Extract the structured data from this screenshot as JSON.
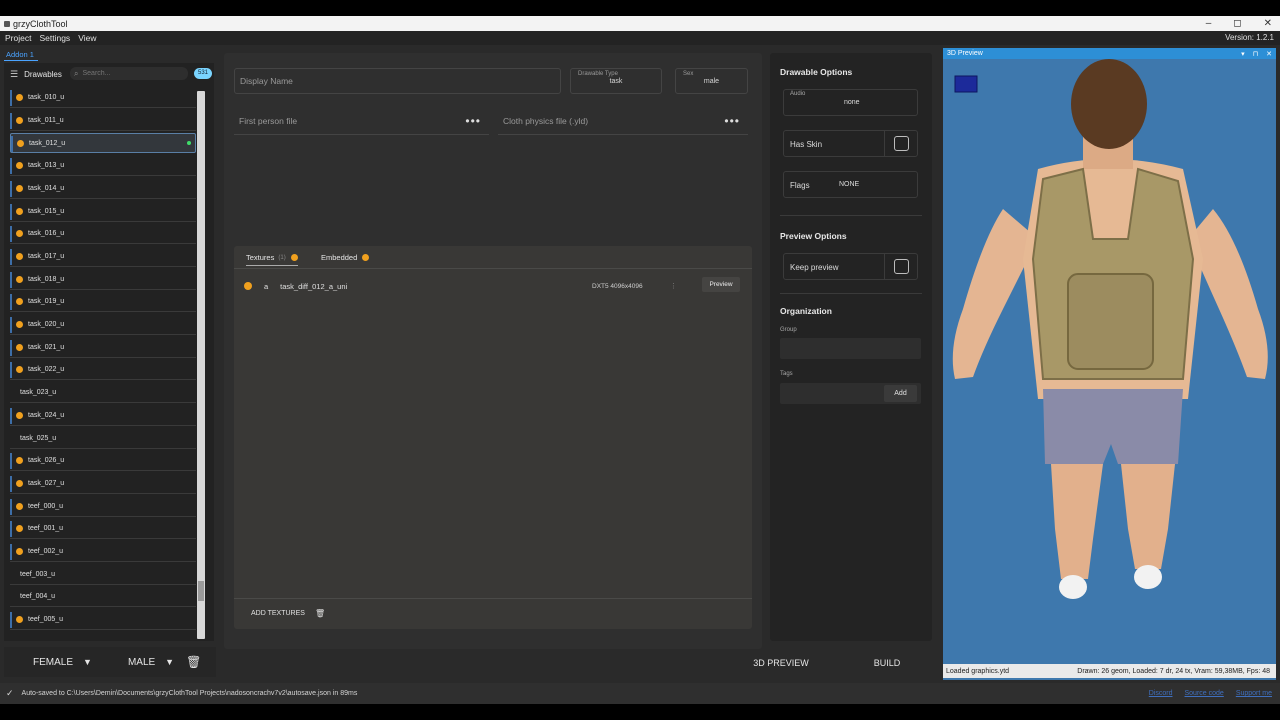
{
  "window": {
    "title": "grzyClothTool",
    "minimize": "–",
    "maximize": "◻",
    "close": "✕"
  },
  "menu": {
    "items": [
      "Project",
      "Settings",
      "View"
    ],
    "version": "Version: 1.2.1"
  },
  "sidebar": {
    "addon_tab": "Addon 1",
    "title": "Drawables",
    "search_placeholder": "Search...",
    "count": "531",
    "items": [
      {
        "label": "task_010_u",
        "warn": true
      },
      {
        "label": "task_011_u",
        "warn": true
      },
      {
        "label": "task_012_u",
        "warn": true,
        "selected": true
      },
      {
        "label": "task_013_u",
        "warn": true
      },
      {
        "label": "task_014_u",
        "warn": true
      },
      {
        "label": "task_015_u",
        "warn": true
      },
      {
        "label": "task_016_u",
        "warn": true
      },
      {
        "label": "task_017_u",
        "warn": true
      },
      {
        "label": "task_018_u",
        "warn": true
      },
      {
        "label": "task_019_u",
        "warn": true
      },
      {
        "label": "task_020_u",
        "warn": true
      },
      {
        "label": "task_021_u",
        "warn": true
      },
      {
        "label": "task_022_u",
        "warn": true
      },
      {
        "label": "task_023_u",
        "warn": false
      },
      {
        "label": "task_024_u",
        "warn": true
      },
      {
        "label": "task_025_u",
        "warn": false
      },
      {
        "label": "task_026_u",
        "warn": true
      },
      {
        "label": "task_027_u",
        "warn": true
      },
      {
        "label": "teef_000_u",
        "warn": true
      },
      {
        "label": "teef_001_u",
        "warn": true
      },
      {
        "label": "teef_002_u",
        "warn": true
      },
      {
        "label": "teef_003_u",
        "warn": false
      },
      {
        "label": "teef_004_u",
        "warn": false
      },
      {
        "label": "teef_005_u",
        "warn": true
      }
    ],
    "female_label": "FEMALE",
    "male_label": "MALE"
  },
  "center": {
    "display_name_placeholder": "Display Name",
    "drawable_type_label": "Drawable Type",
    "drawable_type_value": "task",
    "sex_label": "Sex",
    "sex_value": "male",
    "first_person_placeholder": "First person file",
    "cloth_physics_placeholder": "Cloth physics file (.yld)",
    "dots": "•••",
    "textures_tab": "Textures",
    "textures_count": "(1)",
    "embedded_tab": "Embedded",
    "texture_row": {
      "letter": "a",
      "name": "task_diff_012_a_uni",
      "format": "DXT5  4096x4096",
      "preview": "Preview"
    },
    "add_textures": "ADD TEXTURES"
  },
  "options": {
    "drawable_options": "Drawable Options",
    "audio_label": "Audio",
    "audio_value": "none",
    "has_skin": "Has Skin",
    "flags_label": "Flags",
    "flags_value": "NONE",
    "preview_options": "Preview Options",
    "keep_preview": "Keep preview",
    "organization": "Organization",
    "group_label": "Group",
    "tags_label": "Tags",
    "add": "Add"
  },
  "bottom": {
    "preview_3d": "3D PREVIEW",
    "build": "BUILD"
  },
  "preview": {
    "title": "3D Preview",
    "status_left": "Loaded graphics.ytd",
    "status_right": "Drawn: 26 geom, Loaded: 7 dr, 24 tx, Vram: 59,38MB, Fps: 48",
    "colors": {
      "background": "#3e78ad",
      "skin": "#e8b896",
      "vest": "#a89867",
      "shorts": "#8a8ba8",
      "hair": "#5a3a22"
    }
  },
  "status": {
    "message": "Auto-saved to C:\\Users\\Demin\\Documents\\grzyClothTool Projects\\nadosoncrachv7v2\\autosave.json in 89ms",
    "links": [
      "Discord",
      "Source code",
      "Support me"
    ]
  },
  "icons": {
    "list": "list-icon",
    "search": "search-icon",
    "trash": "trash-icon",
    "check": "check-icon",
    "warning": "warning-icon",
    "caret": "caret-down-icon"
  }
}
